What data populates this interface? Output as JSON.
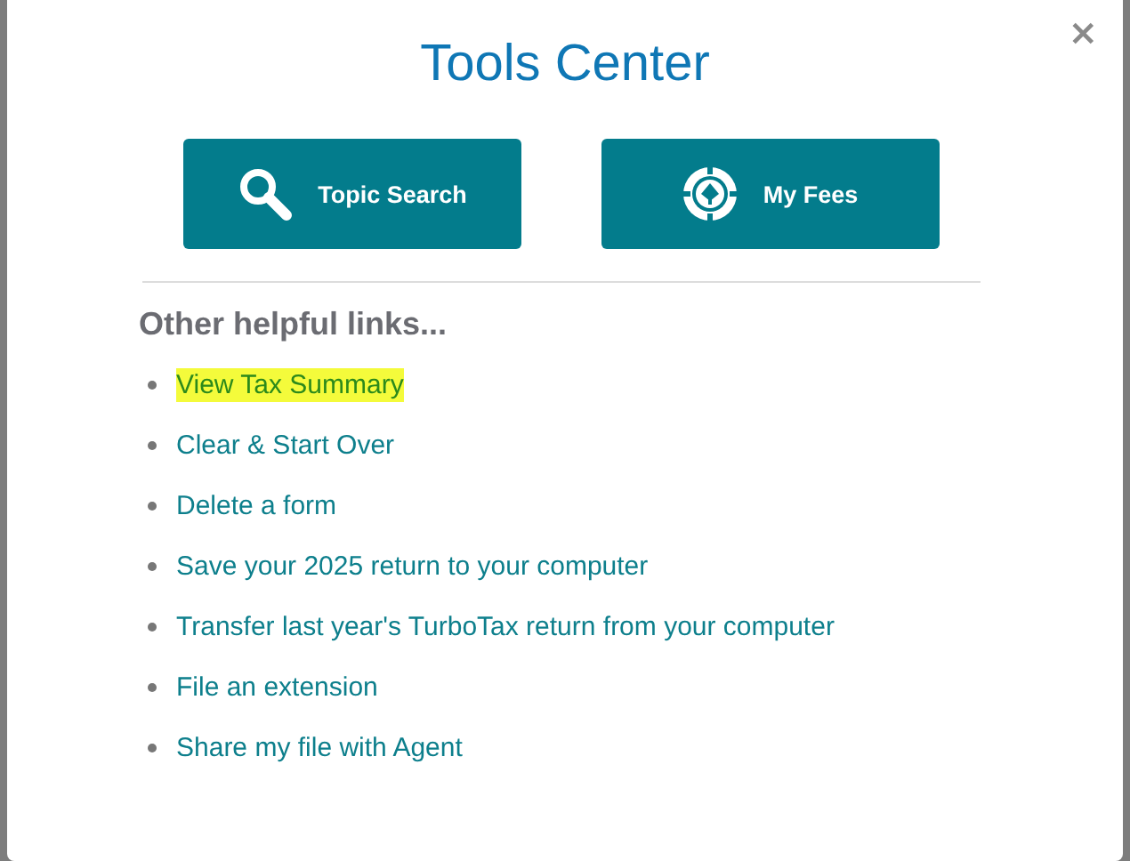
{
  "dialog": {
    "title": "Tools Center",
    "close": "×",
    "buttons": [
      {
        "kind": "search",
        "label": "Topic Search"
      },
      {
        "kind": "fees",
        "label": "My Fees"
      }
    ],
    "links_heading": "Other helpful links...",
    "links": [
      {
        "label": "View Tax Summary",
        "highlighted": true
      },
      {
        "label": "Clear & Start Over",
        "highlighted": false
      },
      {
        "label": "Delete a form",
        "highlighted": false
      },
      {
        "label": "Save your 2025 return to your computer",
        "highlighted": false
      },
      {
        "label": "Transfer last year's TurboTax return from your computer",
        "highlighted": false
      },
      {
        "label": "File an extension",
        "highlighted": false
      },
      {
        "label": "Share my file with Agent",
        "highlighted": false
      }
    ]
  }
}
